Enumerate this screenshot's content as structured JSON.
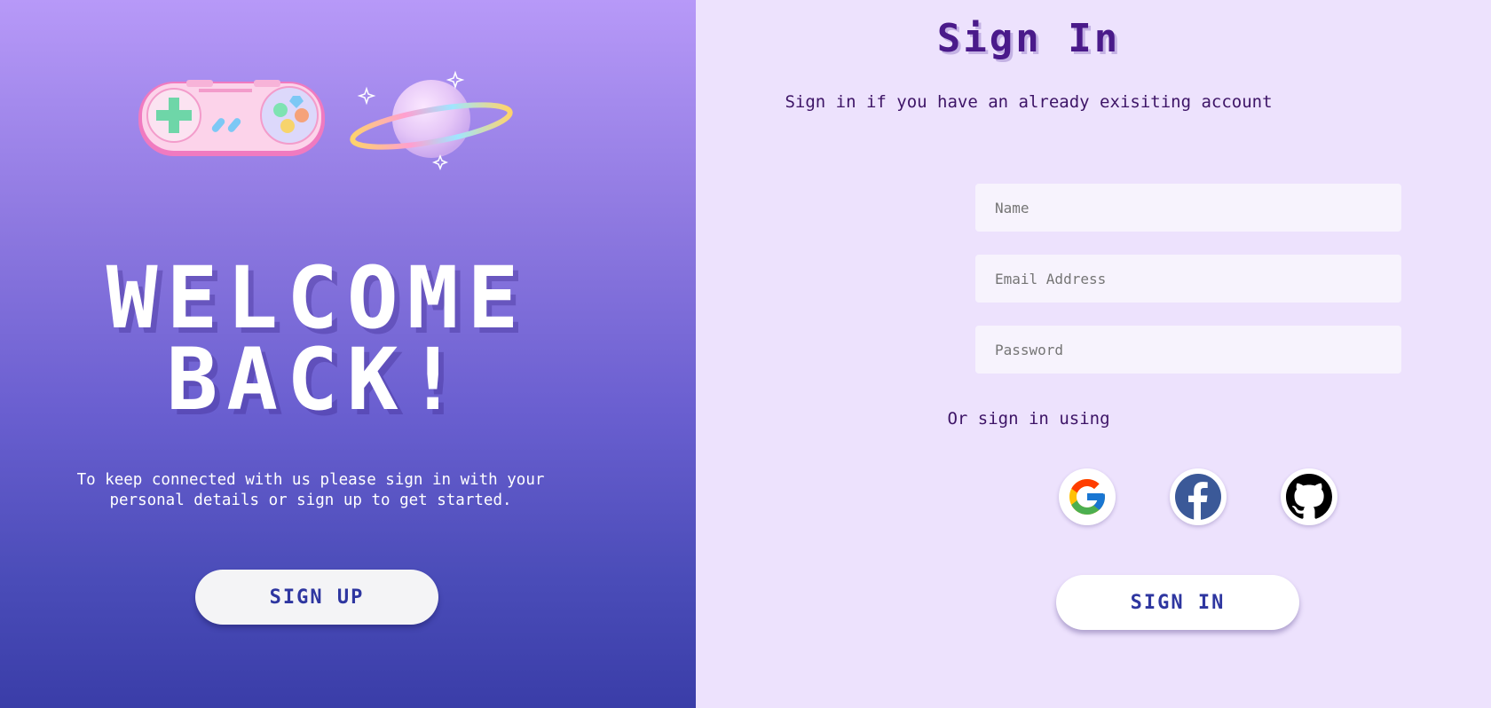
{
  "left_panel": {
    "welcome_line1": "WELCOME",
    "welcome_line2": "BACK!",
    "tagline_line1": "To keep connected with us please sign in with your",
    "tagline_line2": "personal details or sign up to get started.",
    "signup_label": "SIGN UP",
    "decorations": [
      "game-controller-icon",
      "planet-icon"
    ]
  },
  "right_panel": {
    "title": "Sign In",
    "subtitle": "Sign in if you have an already exisiting account",
    "fields": {
      "name_placeholder": "Name",
      "email_placeholder": "Email Address",
      "password_placeholder": "Password"
    },
    "or_text": "Or sign in using",
    "social": [
      "google-icon",
      "facebook-icon",
      "github-icon"
    ],
    "signin_label": "SIGN IN"
  },
  "colors": {
    "gradient_top": "#b799f8",
    "gradient_bottom": "#3a3da8",
    "right_bg": "#ede2fd",
    "title_color": "#4a1a8a",
    "button_text": "#2e36a0"
  }
}
